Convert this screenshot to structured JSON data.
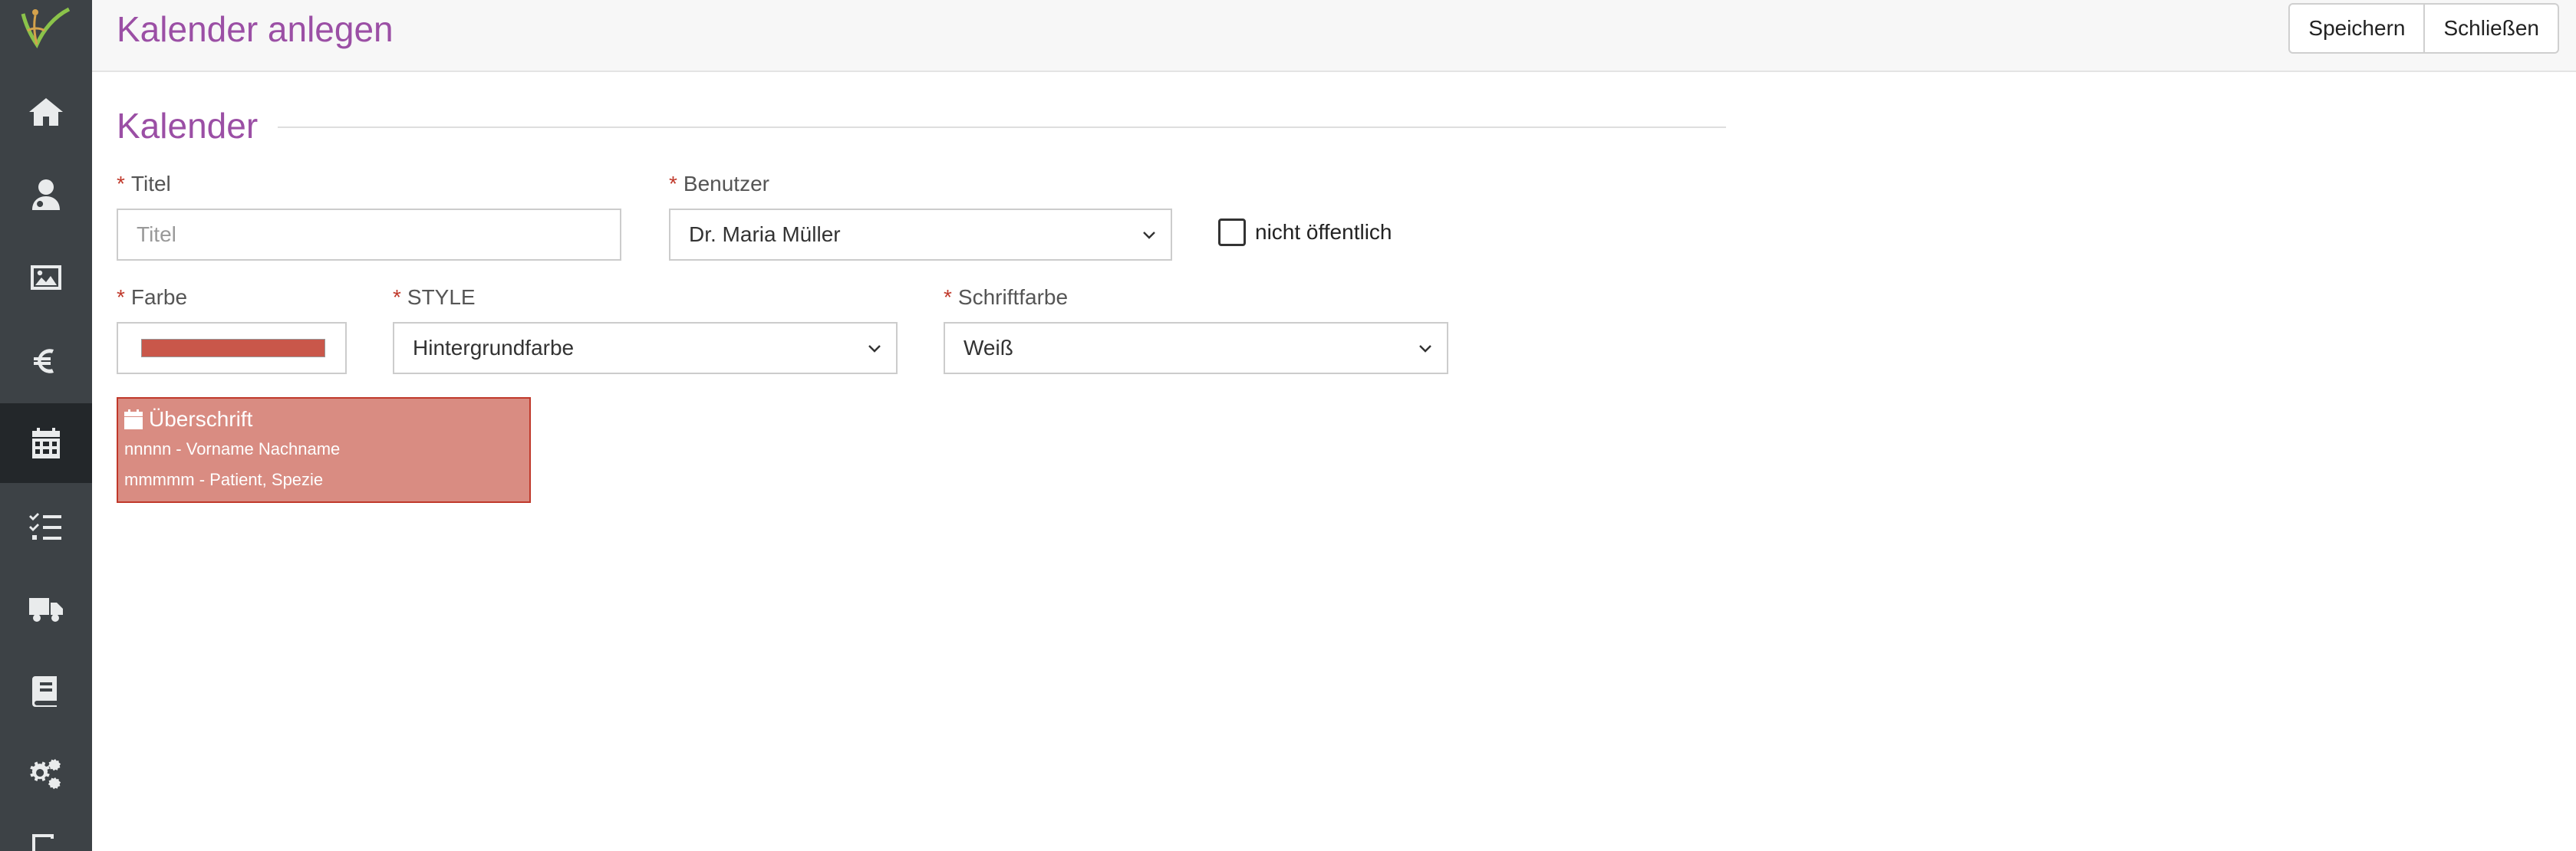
{
  "sidebar": {
    "items": [
      {
        "icon": "home-icon",
        "active": false
      },
      {
        "icon": "user-doctor-icon",
        "active": false
      },
      {
        "icon": "image-icon",
        "active": false
      },
      {
        "icon": "euro-icon",
        "active": false
      },
      {
        "icon": "calendar-icon",
        "active": true
      },
      {
        "icon": "task-list-icon",
        "active": false
      },
      {
        "icon": "truck-icon",
        "active": false
      },
      {
        "icon": "book-icon",
        "active": false
      },
      {
        "icon": "settings-gears-icon",
        "active": false
      },
      {
        "icon": "export-icon",
        "active": false
      }
    ]
  },
  "header": {
    "title": "Kalender anlegen",
    "save_label": "Speichern",
    "close_label": "Schließen"
  },
  "form": {
    "section_title": "Kalender",
    "required_marker": "*",
    "title_label": "Titel",
    "title_placeholder": "Titel",
    "title_value": "",
    "user_label": "Benutzer",
    "user_value": "Dr. Maria Müller",
    "private_label": "nicht öffentlich",
    "private_checked": false,
    "color_label": "Farbe",
    "color_value": "#c9574a",
    "style_label": "STYLE",
    "style_value": "Hintergrundfarbe",
    "font_color_label": "Schriftfarbe",
    "font_color_value": "Weiß"
  },
  "preview": {
    "heading": "Überschrift",
    "line1": "nnnnn - Vorname Nachname",
    "line2": "mmmmm - Patient, Spezie",
    "background": "#d98c82",
    "border": "#c0392b",
    "text_color": "#ffffff"
  },
  "colors": {
    "accent": "#9b4fa5",
    "sidebar_bg": "#3d4246",
    "sidebar_active": "#23272a",
    "required": "#c0392b"
  }
}
